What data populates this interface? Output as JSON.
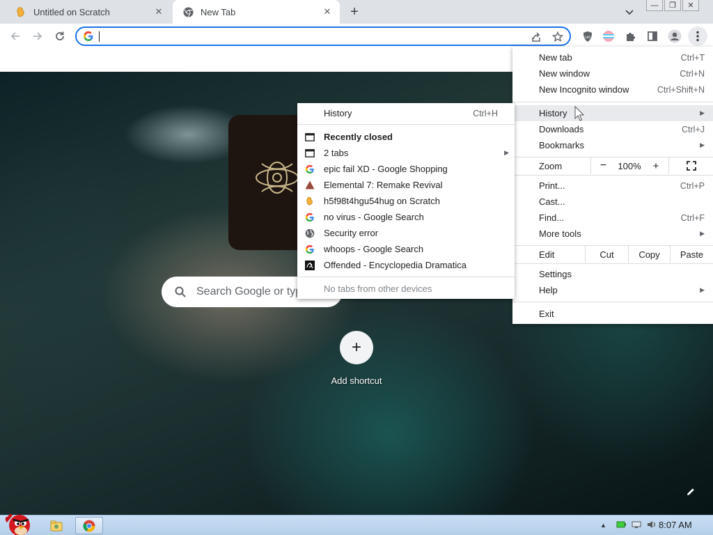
{
  "tabs": [
    {
      "title": "Untitled on Scratch",
      "favicon": "scratch-cat-icon",
      "active": false
    },
    {
      "title": "New Tab",
      "favicon": "chrome-icon",
      "active": true
    }
  ],
  "omnibox": {
    "value": ""
  },
  "ntp": {
    "search_placeholder": "Search Google or typ",
    "add_shortcut_label": "Add shortcut"
  },
  "main_menu": {
    "new_tab": {
      "label": "New tab",
      "shortcut": "Ctrl+T"
    },
    "new_window": {
      "label": "New window",
      "shortcut": "Ctrl+N"
    },
    "new_incognito": {
      "label": "New Incognito window",
      "shortcut": "Ctrl+Shift+N"
    },
    "history": {
      "label": "History"
    },
    "downloads": {
      "label": "Downloads",
      "shortcut": "Ctrl+J"
    },
    "bookmarks": {
      "label": "Bookmarks"
    },
    "zoom": {
      "label": "Zoom",
      "minus": "−",
      "value": "100%",
      "plus": "+"
    },
    "print": {
      "label": "Print...",
      "shortcut": "Ctrl+P"
    },
    "cast": {
      "label": "Cast..."
    },
    "find": {
      "label": "Find...",
      "shortcut": "Ctrl+F"
    },
    "more_tools": {
      "label": "More tools"
    },
    "edit": {
      "label": "Edit",
      "cut": "Cut",
      "copy": "Copy",
      "paste": "Paste"
    },
    "settings": {
      "label": "Settings"
    },
    "help": {
      "label": "Help"
    },
    "exit": {
      "label": "Exit"
    }
  },
  "history_menu": {
    "history": {
      "label": "History",
      "shortcut": "Ctrl+H"
    },
    "recently_closed_header": "Recently closed",
    "items": [
      {
        "label": "2 tabs",
        "icon": "tab-window-icon"
      },
      {
        "label": "epic fail XD - Google Shopping",
        "icon": "google-g-icon"
      },
      {
        "label": "Elemental 7: Remake Revival",
        "icon": "triangle-icon"
      },
      {
        "label": "h5f98t4hgu54hug on Scratch",
        "icon": "scratch-cat-icon"
      },
      {
        "label": "no virus - Google Search",
        "icon": "google-g-icon"
      },
      {
        "label": "Security error",
        "icon": "globe-icon"
      },
      {
        "label": "whoops - Google Search",
        "icon": "google-g-icon"
      },
      {
        "label": "Offended - Encyclopedia Dramatica",
        "icon": "ed-logo-icon"
      }
    ],
    "other_devices": "No tabs from other devices"
  },
  "taskbar": {
    "clock": "8:07 AM"
  },
  "colors": {
    "accent": "#1a73e8",
    "tabstrip": "#dee1e6",
    "menu_highlight": "#e8eaed"
  }
}
